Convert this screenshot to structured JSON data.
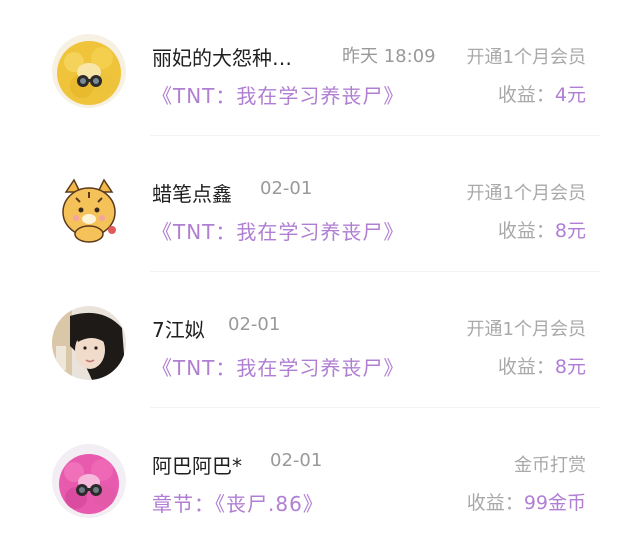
{
  "colors": {
    "accent_purple": "#b07fd3",
    "muted_gray": "#a9a9a9",
    "name_text": "#1f1f1f"
  },
  "records": [
    {
      "avatar_icon": "yellow-fluffy-chick-avatar-icon",
      "name": "丽妃的大怨种…",
      "time": "昨天 18:09",
      "type": "开通1个月会员",
      "book": "《TNT：我在学习养丧尸》",
      "income_label": "收益：",
      "income_value": "4元"
    },
    {
      "avatar_icon": "cartoon-tiger-avatar-icon",
      "name": "蜡笔点鑫",
      "time": "02-01",
      "type": "开通1个月会员",
      "book": "《TNT：我在学习养丧尸》",
      "income_label": "收益：",
      "income_value": "8元"
    },
    {
      "avatar_icon": "portrait-photo-avatar-icon",
      "name": "7江姒",
      "time": "02-01",
      "type": "开通1个月会员",
      "book": "《TNT：我在学习养丧尸》",
      "income_label": "收益：",
      "income_value": "8元"
    },
    {
      "avatar_icon": "pink-fluffy-chick-avatar-icon",
      "name": "阿巴阿巴*",
      "time": "02-01",
      "type": "金币打赏",
      "book": "章节：《丧尸.86》",
      "income_label": "收益：",
      "income_value": "99金币"
    }
  ]
}
